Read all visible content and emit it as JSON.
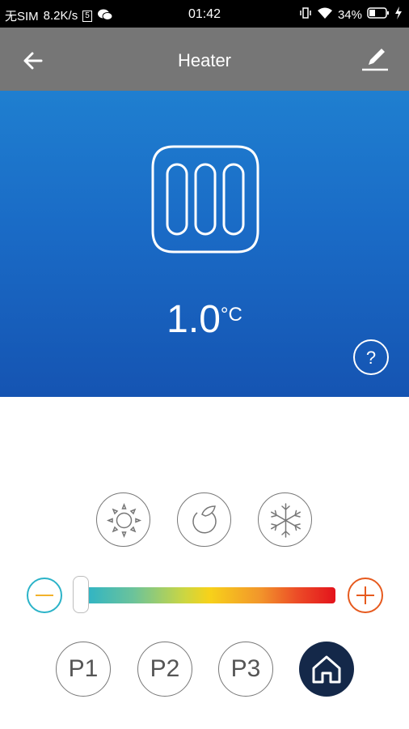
{
  "status_bar": {
    "carrier": "无SIM",
    "speed": "8.2K/s",
    "sim_badge": "5",
    "time": "01:42",
    "battery": "34%"
  },
  "app_bar": {
    "title": "Heater",
    "back_icon": "arrow-left-icon",
    "edit_icon": "pencil-icon"
  },
  "hero": {
    "device_icon": "heater-icon",
    "temperature_value": "1.0",
    "temperature_unit": "°C",
    "help_label": "?",
    "gradient_colors": [
      "#1f7fd0",
      "#1554b2"
    ]
  },
  "modes": [
    {
      "name": "heat",
      "icon": "sun-icon"
    },
    {
      "name": "eco",
      "icon": "leaf-icon"
    },
    {
      "name": "cool",
      "icon": "snowflake-icon"
    }
  ],
  "slider": {
    "minus_color": "#2bb3c8",
    "plus_color": "#e65a1e",
    "position": 0.0
  },
  "presets": [
    {
      "label": "P1"
    },
    {
      "label": "P2"
    },
    {
      "label": "P3"
    }
  ],
  "home_button": {
    "icon": "home-icon",
    "color": "#142849"
  }
}
